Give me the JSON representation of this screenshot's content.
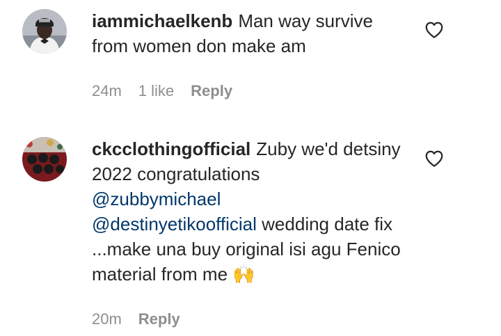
{
  "comments": [
    {
      "username": "iammichaelkenb",
      "text": "Man way survive from women don make am",
      "time": "24m",
      "likes": "1 like",
      "reply_label": "Reply",
      "avatar_icon": "profile-photo"
    },
    {
      "username": "ckcclothingofficial",
      "text_before": "Zuby we'd detsiny 2022 congratulations",
      "mention_1": "@zubbymichael",
      "mention_2": "@destinyetikoofficial",
      "text_after": "wedding date fix ...make una buy original isi agu Fenico material from me",
      "emoji": "🙌",
      "time": "20m",
      "reply_label": "Reply",
      "avatar_icon": "fabric-photo"
    }
  ],
  "icons": {
    "like": "heart-outline-icon"
  },
  "colors": {
    "text": "#262626",
    "meta": "#8e8e8e",
    "mention": "#00376b"
  }
}
